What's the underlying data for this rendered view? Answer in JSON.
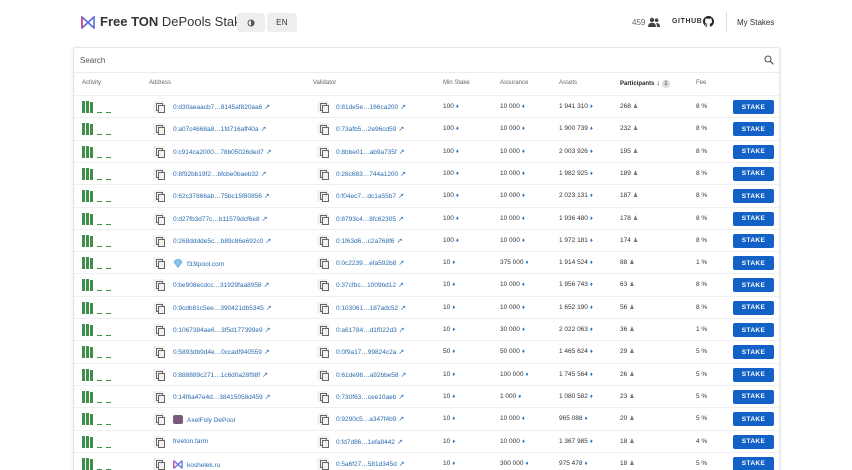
{
  "header": {
    "brand_bold": "Free TON",
    "brand_rest": " DePools Staking",
    "theme_icon": "theme-toggle-icon",
    "lang_label": "EN",
    "online_count": "459",
    "github_label": "GITHUB",
    "mystakes_label": "My Stakes"
  },
  "search": {
    "label": "Search"
  },
  "columns": {
    "activity": "Activity",
    "address": "Address",
    "validator": "Validator",
    "min_stake": "Min Stake",
    "assurance": "Assurance",
    "assets": "Assets",
    "participants": "Participants",
    "participants_badge": "1",
    "fee": "Fee"
  },
  "colors": {
    "accent": "#1261c6",
    "link": "#2b6cb0",
    "activity": "#3f8f4a"
  },
  "rows": [
    {
      "address": "0:d30aeaacb7…8145af820aa6",
      "validator": "0:81de5e…166ca200",
      "min_stake": "100",
      "assurance": "10 000",
      "assets": "1 941 310",
      "participants": "268",
      "fee": "8 %",
      "stake": "STAKE"
    },
    {
      "address": "0:a07c4668a8…1fd716aff40a",
      "validator": "0:73afb5…2e96cd59",
      "min_stake": "100",
      "assurance": "10 000",
      "assets": "1 900 739",
      "participants": "232",
      "fee": "8 %",
      "stake": "STAKE"
    },
    {
      "address": "0:c914ca2000…78b05026ded7",
      "validator": "0:8bbe01…ab9a735f",
      "min_stake": "100",
      "assurance": "10 000",
      "assets": "2 003 926",
      "participants": "195",
      "fee": "8 %",
      "stake": "STAKE"
    },
    {
      "address": "0:8f92bb19f2…bfcbe0baeb32",
      "validator": "0:28c683…744a1200",
      "min_stake": "100",
      "assurance": "10 000",
      "assets": "1 982 925",
      "participants": "189",
      "fee": "8 %",
      "stake": "STAKE"
    },
    {
      "address": "0:62c37866ab…75bc15f80856",
      "validator": "0:f04ec7…dc1a55b7",
      "min_stake": "100",
      "assurance": "10 000",
      "assets": "2 023 131",
      "participants": "187",
      "fee": "8 %",
      "stake": "STAKE"
    },
    {
      "address": "0:d27fb3d77c…b11579dcf6e8",
      "validator": "0:8793c4…8fc62305",
      "min_stake": "100",
      "assurance": "10 000",
      "assets": "1 936 480",
      "participants": "178",
      "fee": "8 %",
      "stake": "STAKE"
    },
    {
      "address": "0:268dddde5c…b89c86e692c0",
      "validator": "0:1f63d6…c2a768f6",
      "min_stake": "100",
      "assurance": "10 000",
      "assets": "1 972 181",
      "participants": "174",
      "fee": "8 %",
      "stake": "STAKE"
    },
    {
      "address": "f33tpool.com",
      "validator": "0:0c2239…efa592b8",
      "min_stake": "10",
      "assurance": "375 000",
      "assets": "1 914 524",
      "participants": "88",
      "fee": "1 %",
      "stake": "STAKE"
    },
    {
      "address": "0:be908ecdcc…31929faa8958",
      "validator": "0:37cfbc…1009bd12",
      "min_stake": "10",
      "assurance": "10 000",
      "assets": "1 956 743",
      "participants": "63",
      "fee": "8 %",
      "stake": "STAKE"
    },
    {
      "address": "0:9cdb81c5ee…390421db5345",
      "validator": "0:103061…187adc52",
      "min_stake": "10",
      "assurance": "10 000",
      "assets": "1 652 190",
      "participants": "56",
      "fee": "8 %",
      "stake": "STAKE"
    },
    {
      "address": "0:1067384ae6…3f5d177399e9",
      "validator": "0:a61784…d1f022d3",
      "min_stake": "10",
      "assurance": "30 000",
      "assets": "2 022 063",
      "participants": "36",
      "fee": "1 %",
      "stake": "STAKE"
    },
    {
      "address": "0:5893db9d4e…0ccadf940559",
      "validator": "0:0f9a17…99824c2a",
      "min_stake": "50",
      "assurance": "50 000",
      "assets": "1 465 624",
      "participants": "29",
      "fee": "5 %",
      "stake": "STAKE"
    },
    {
      "address": "0:888889c271…1c6d0a28f98f",
      "validator": "0:61de96…a92bbe58",
      "min_stake": "10",
      "assurance": "100 000",
      "assets": "1 745 564",
      "participants": "26",
      "fee": "5 %",
      "stake": "STAKE"
    },
    {
      "address": "0:14f6a47e4d…38415058d459",
      "validator": "0:730f63…cee10aeb",
      "min_stake": "10",
      "assurance": "1 000",
      "assets": "1 080 582",
      "participants": "23",
      "fee": "5 %",
      "stake": "STAKE"
    },
    {
      "address": "AxelFoly DePool",
      "validator": "0:9290c5…a347f4b9",
      "min_stake": "10",
      "assurance": "10 000",
      "assets": "965 088",
      "participants": "20",
      "fee": "5 %",
      "stake": "STAKE"
    },
    {
      "address": "freeton.farm",
      "validator": "0:fd7d86…1efa8442",
      "min_stake": "10",
      "assurance": "10 000",
      "assets": "1 367 985",
      "participants": "18",
      "fee": "4 %",
      "stake": "STAKE"
    },
    {
      "address": "koshelek.ru",
      "validator": "0:5a6f27…581d345d",
      "min_stake": "10",
      "assurance": "300 000",
      "assets": "975 478",
      "participants": "18",
      "fee": "5 %",
      "stake": "STAKE"
    }
  ]
}
